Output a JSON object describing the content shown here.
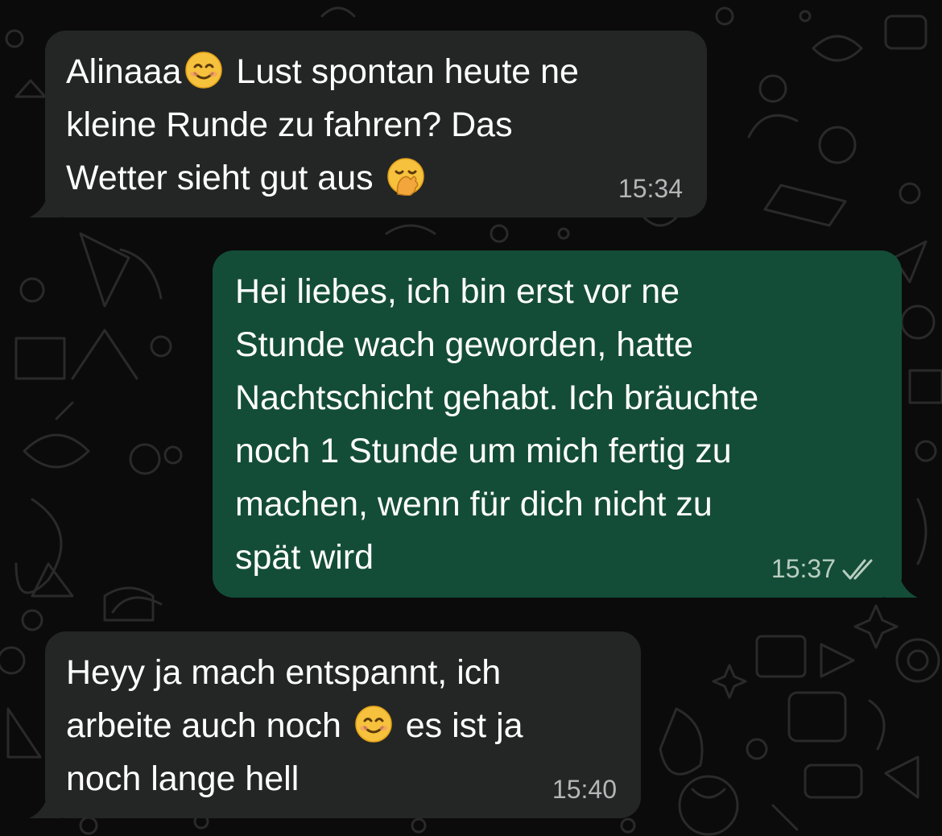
{
  "colors": {
    "background": "#0b0b0b",
    "incoming_bubble": "#242626",
    "outgoing_bubble": "#144d37",
    "text": "#ffffff",
    "incoming_time": "#b3b6b6",
    "outgoing_time": "#b7cdc1"
  },
  "messages": [
    {
      "direction": "incoming",
      "segments": [
        "Alinaaa",
        "smiling-face-emoji",
        " Lust spontan heute ne\nkleine Runde zu fahren? Das\nWetter sieht gut aus ",
        "hand-over-mouth-emoji"
      ],
      "text_1": "Alinaaa",
      "text_2": " Lust spontan heute ne\nkleine Runde zu fahren? Das\nWetter sieht gut aus ",
      "time": "15:34"
    },
    {
      "direction": "outgoing",
      "text": "Hei liebes, ich bin erst vor ne\nStunde wach geworden, hatte\nNachtschicht gehabt. Ich bräuchte\nnoch 1 Stunde um mich fertig zu\nmachen, wenn für dich nicht zu\nspät wird",
      "time": "15:37",
      "status_icon": "double-check-icon"
    },
    {
      "direction": "incoming",
      "segments": [
        "Heyy ja mach entspannt, ich\narbeite auch noch ",
        "smiling-face-emoji",
        " es ist ja\nnoch lange hell"
      ],
      "text_1": "Heyy ja mach entspannt, ich\narbeite auch noch ",
      "text_2": " es ist ja\nnoch lange hell",
      "time": "15:40"
    }
  ]
}
